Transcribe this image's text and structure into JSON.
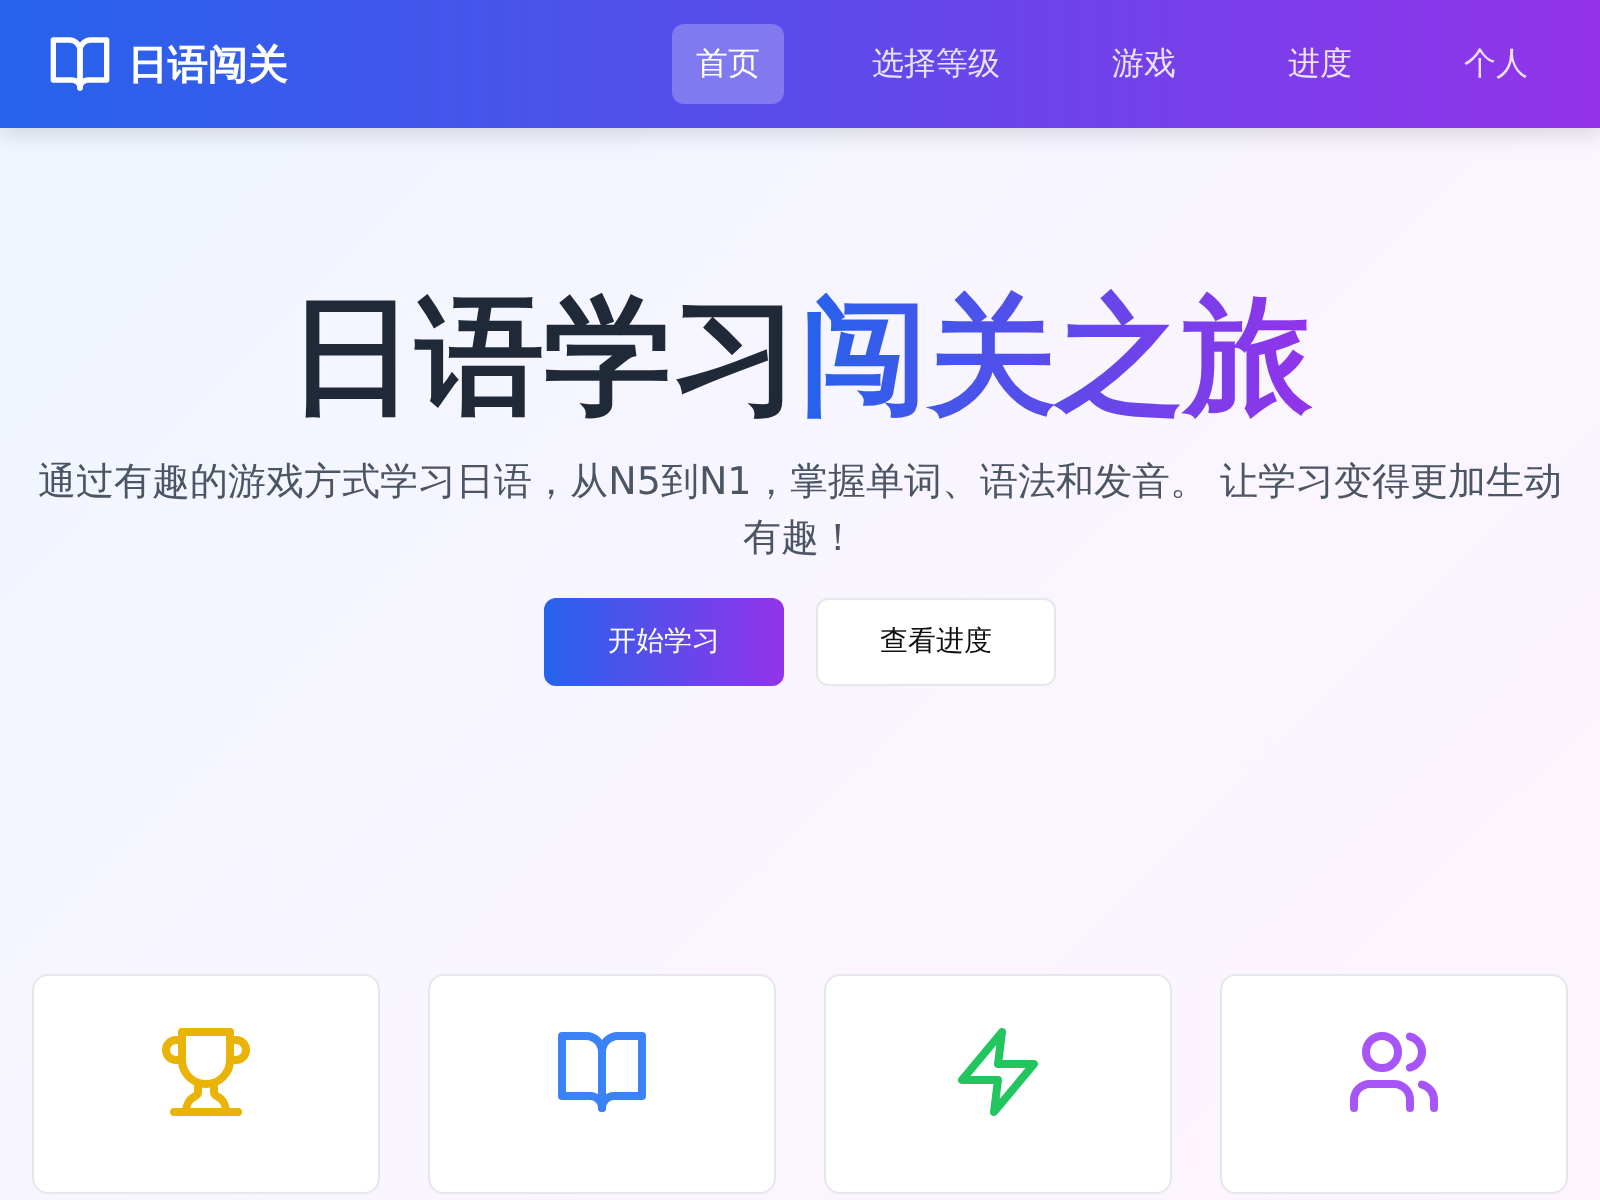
{
  "brand": {
    "name": "日语闯关"
  },
  "nav": [
    {
      "label": "首页",
      "selected": true
    },
    {
      "label": "选择等级",
      "selected": false
    },
    {
      "label": "游戏",
      "selected": false
    },
    {
      "label": "进度",
      "selected": false
    },
    {
      "label": "个人",
      "selected": false
    }
  ],
  "hero": {
    "title_lead": "日语学习",
    "title_highlight": "闯关之旅",
    "subtitle": "通过有趣的游戏方式学习日语，从N5到N1，掌握单词、语法和发音。 让学习变得更加生动有趣！",
    "buttons": [
      {
        "label": "开始学习",
        "kind": "primary"
      },
      {
        "label": "查看进度",
        "kind": "outline"
      }
    ]
  },
  "features": [
    {
      "kind": "trophy",
      "color": "#eab308"
    },
    {
      "kind": "book",
      "color": "#3b82f6"
    },
    {
      "kind": "bolt",
      "color": "#22c55e"
    },
    {
      "kind": "users",
      "color": "#a855f7"
    }
  ]
}
